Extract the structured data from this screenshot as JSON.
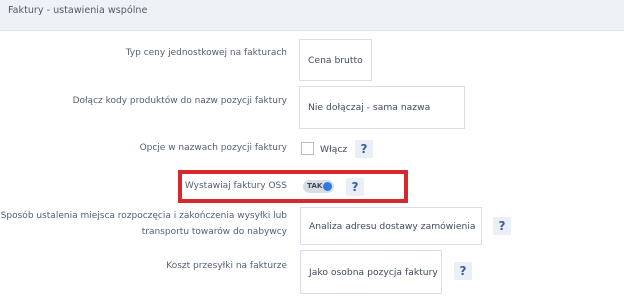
{
  "header": {
    "title": "Faktury - ustawienia wspólne"
  },
  "rows": {
    "price_type": {
      "label": "Typ ceny jednostkowej na fakturach",
      "value": "Cena brutto"
    },
    "product_codes": {
      "label": "Dołącz kody produktów do nazw pozycji faktury",
      "value": "Nie dołączaj - sama nazwa"
    },
    "name_options": {
      "label": "Opcje w nazwach pozycji faktury",
      "checkbox_label": "Włącz",
      "checked": false,
      "help": "?"
    },
    "oss": {
      "label": "Wystawiaj faktury OSS",
      "toggle_text": "TAK",
      "enabled": true,
      "help": "?"
    },
    "place_method": {
      "label_line1": "Sposób ustalenia miejsca rozpoczęcia i zakończenia wysyłki lub",
      "label_line2": "transportu towarów do nabywcy",
      "value": "Analiza adresu dostawy zamówienia",
      "help": "?"
    },
    "shipping_cost": {
      "label": "Koszt przesyłki na fakturze",
      "value": "Jako osobna pozycja faktury",
      "help": "?"
    }
  },
  "colors": {
    "highlight_border": "#d7282d",
    "toggle_knob": "#2a7de0",
    "header_bg": "#eef1f6"
  }
}
